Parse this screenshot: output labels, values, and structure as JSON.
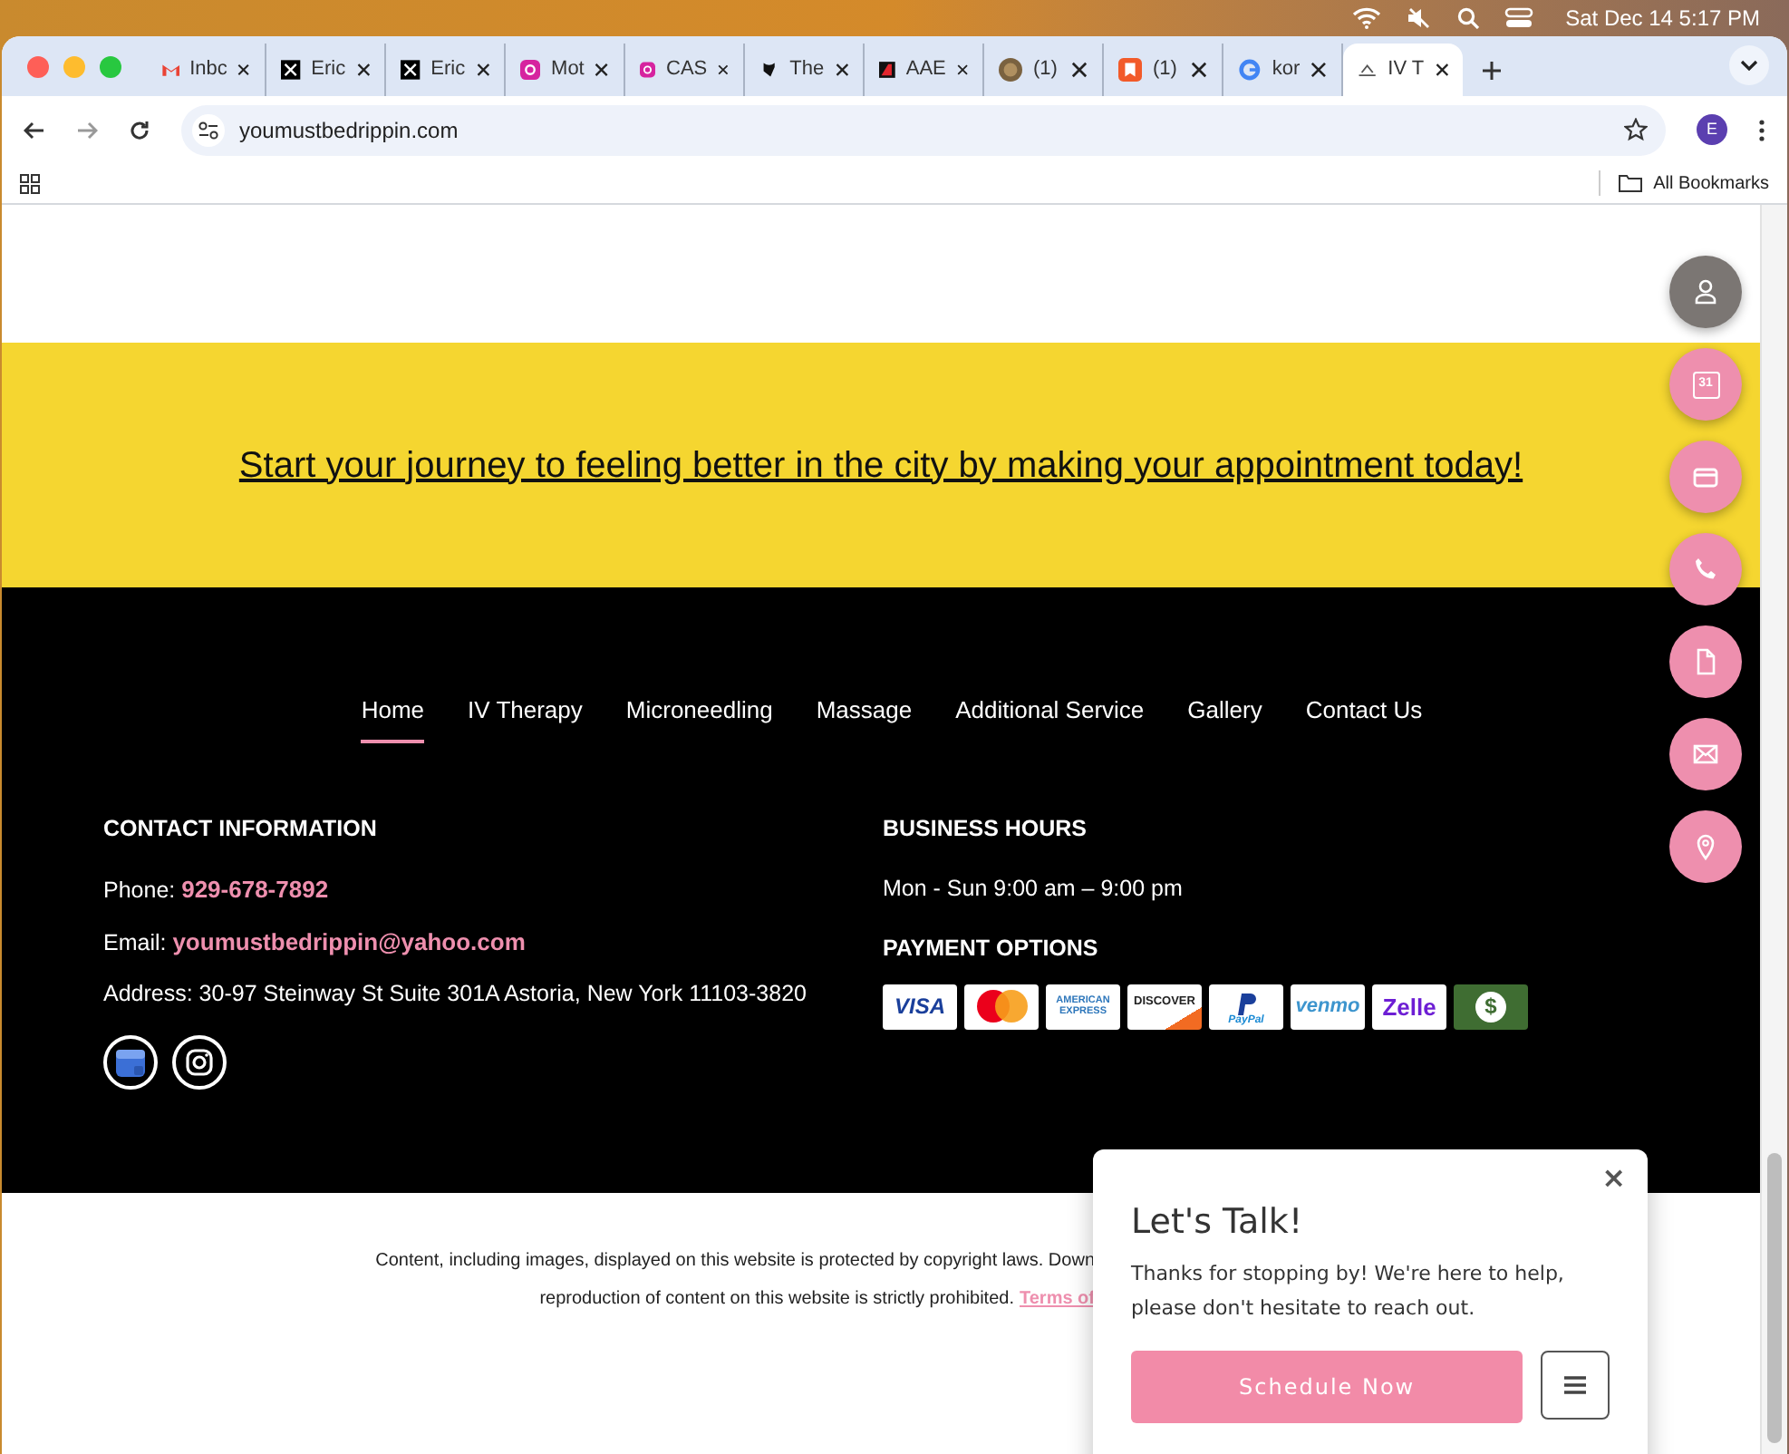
{
  "menu_bar": {
    "clock": "Sat Dec 14  5:17 PM"
  },
  "tabs": [
    {
      "title": "Inbc",
      "selected": false
    },
    {
      "title": "Eric",
      "selected": false
    },
    {
      "title": "Eric",
      "selected": false
    },
    {
      "title": "Mot",
      "selected": false
    },
    {
      "title": "CAS",
      "selected": false
    },
    {
      "title": "The",
      "selected": false
    },
    {
      "title": "AAE",
      "selected": false
    },
    {
      "title": "(1)",
      "selected": false
    },
    {
      "title": "(1)",
      "selected": false
    },
    {
      "title": "kor",
      "selected": false
    },
    {
      "title": "IV T",
      "selected": true
    }
  ],
  "address_bar": {
    "url": "youmustbedrippin.com",
    "profile": "E"
  },
  "bookmarks_bar": {
    "all_bookmarks": "All Bookmarks"
  },
  "banner": {
    "link": "Start your journey to feeling better in the city by making your appointment today!"
  },
  "footer_nav": [
    {
      "label": "Home",
      "selected": true
    },
    {
      "label": "IV Therapy",
      "selected": false
    },
    {
      "label": "Microneedling",
      "selected": false
    },
    {
      "label": "Massage",
      "selected": false
    },
    {
      "label": "Additional Service",
      "selected": false
    },
    {
      "label": "Gallery",
      "selected": false
    },
    {
      "label": "Contact Us",
      "selected": false
    }
  ],
  "contact": {
    "heading": "CONTACT INFORMATION",
    "phone_label": "Phone:",
    "phone": "929-678-7892",
    "email_label": "Email:",
    "email": "youmustbedrippin@yahoo.com",
    "address": "Address: 30-97 Steinway St Suite 301A Astoria, New York 11103-3820"
  },
  "hours": {
    "heading": "BUSINESS HOURS",
    "text": "Mon - Sun 9:00 am – 9:00 pm"
  },
  "payment": {
    "heading": "PAYMENT OPTIONS",
    "options": [
      {
        "kind": "visa",
        "label": "VISA"
      },
      {
        "kind": "mastercard"
      },
      {
        "kind": "amex",
        "label": "AMERICAN EXPRESS"
      },
      {
        "kind": "discover",
        "label": "DISCOVER"
      },
      {
        "kind": "paypal",
        "label": "PayPal"
      },
      {
        "kind": "venmo",
        "label": "venmo"
      },
      {
        "kind": "zelle",
        "label": "Zelle"
      },
      {
        "kind": "cash",
        "label": "$"
      }
    ]
  },
  "copyright": {
    "line_1": "Content, including images, displayed on this website is protected by copyright laws. Down",
    "line_2": "reproduction of content on this website is strictly prohibited.",
    "link": "Terms of"
  },
  "floating_buttons": [
    {
      "color": "#7b7673"
    },
    {
      "color": "#ee8fae",
      "label": "31"
    },
    {
      "color": "#ee8fae"
    },
    {
      "color": "#ee8fae"
    },
    {
      "color": "#ee8fae"
    },
    {
      "color": "#ee8fae"
    },
    {
      "color": "#ee8fae"
    }
  ],
  "chat_popup": {
    "close": "×",
    "title": "Let's Talk!",
    "message": "Thanks for stopping by! We're here to help, please don't hesitate to reach out.",
    "button": "Schedule Now"
  }
}
